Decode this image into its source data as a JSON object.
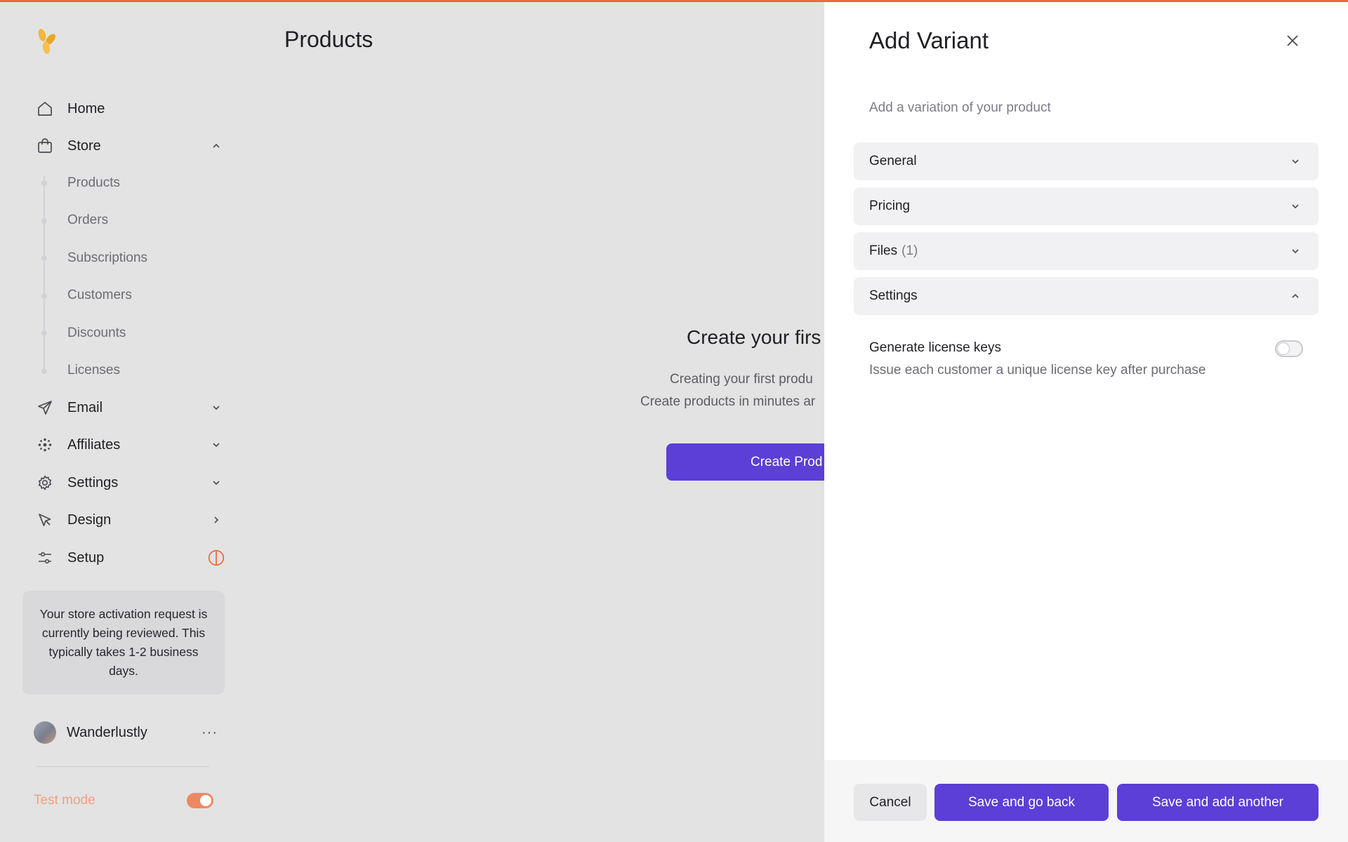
{
  "colors": {
    "accent": "#5b3fd6",
    "top_bar": "#ee6a35",
    "test_mode": "#eb8a62"
  },
  "sidebar": {
    "logo_icon": "brand-flower-icon",
    "nav": [
      {
        "label": "Home",
        "icon": "home-icon"
      },
      {
        "label": "Store",
        "icon": "shopping-bag-icon",
        "expanded": true
      },
      {
        "label": "Email",
        "icon": "send-icon"
      },
      {
        "label": "Affiliates",
        "icon": "network-icon"
      },
      {
        "label": "Settings",
        "icon": "gear-icon"
      },
      {
        "label": "Design",
        "icon": "cursor-icon"
      },
      {
        "label": "Setup",
        "icon": "sliders-icon"
      }
    ],
    "store_items": [
      "Products",
      "Orders",
      "Subscriptions",
      "Customers",
      "Discounts",
      "Licenses"
    ],
    "notice": "Your store activation request is currently being reviewed. This typically takes 1-2 business days.",
    "user": {
      "name": "Wanderlustly",
      "more": "···"
    },
    "test_mode": {
      "label": "Test mode",
      "enabled": true
    }
  },
  "main": {
    "title": "Products",
    "empty_title": "Create your firs",
    "empty_line1": "Creating your first produ",
    "empty_line2": "Create products in minutes ar",
    "create_button": "Create Prod"
  },
  "panel": {
    "title": "Add Variant",
    "subtitle": "Add a variation of your product",
    "sections": [
      {
        "label": "General",
        "count": "",
        "expanded": false
      },
      {
        "label": "Pricing",
        "count": "",
        "expanded": false
      },
      {
        "label": "Files",
        "count": "(1)",
        "expanded": false
      },
      {
        "label": "Settings",
        "count": "",
        "expanded": true
      }
    ],
    "license": {
      "title": "Generate license keys",
      "description": "Issue each customer a unique license key after purchase",
      "enabled": false
    },
    "buttons": {
      "cancel": "Cancel",
      "save_back": "Save and go back",
      "save_add": "Save and add another"
    }
  }
}
